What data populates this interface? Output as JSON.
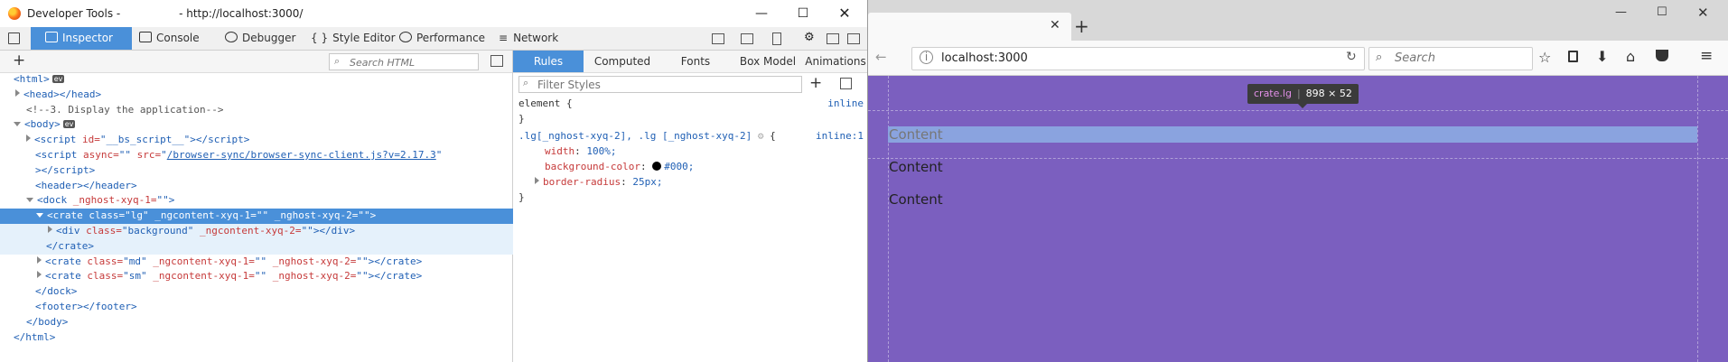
{
  "devtools": {
    "title": "Developer Tools -                 - http://localhost:3000/",
    "toolbar": {
      "tabs": [
        {
          "label": "Inspector",
          "icon": "inspector-icon"
        },
        {
          "label": "Console",
          "icon": "console-icon"
        },
        {
          "label": "Debugger",
          "icon": "debugger-icon"
        },
        {
          "label": "Style Editor",
          "icon": "style-editor-icon"
        },
        {
          "label": "Performance",
          "icon": "performance-icon"
        },
        {
          "label": "Network",
          "icon": "network-icon"
        }
      ]
    },
    "markup": {
      "search_placeholder": "Search HTML",
      "add_node_label": "+"
    },
    "rules": {
      "tabs": [
        "Rules",
        "Computed",
        "Fonts",
        "Box Model",
        "Animations"
      ],
      "filter_placeholder": "Filter Styles",
      "element_selector": "element {",
      "element_close": "}",
      "element_source": "inline",
      "rule_selector": ".lg[_nghost-xyq-2], .lg [_nghost-xyq-2] ",
      "rule_open": " {",
      "rule_source": "inline:1",
      "properties": [
        {
          "name": "width",
          "value": "100%;"
        },
        {
          "name": "background-color",
          "value": "#000;"
        },
        {
          "name": "border-radius",
          "value": "25px;"
        }
      ],
      "rule_close": "}"
    }
  },
  "browser": {
    "url": "localhost:3000",
    "search_placeholder": "Search",
    "tooltip": {
      "selector": "crate.lg",
      "size": "898 × 52"
    },
    "content_lines": [
      "Content",
      "Content",
      "Content"
    ]
  },
  "colors": {
    "accent": "#4a90d9",
    "page_bg": "#7b5fbf",
    "highlight": "#8aa3df"
  }
}
